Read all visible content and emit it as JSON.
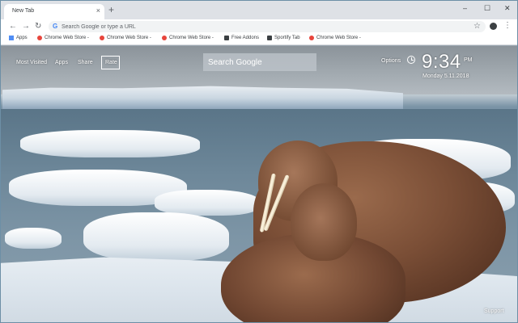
{
  "browser": {
    "tab": {
      "title": "New Tab",
      "close_icon": "×"
    },
    "new_tab_icon": "+",
    "window_controls": {
      "minimize": "–",
      "maximize": "☐",
      "close": "✕"
    },
    "nav": {
      "back": "←",
      "forward": "→",
      "reload": "↻"
    },
    "omnibox": {
      "placeholder": "Search Google or type a URL",
      "logo": "G"
    },
    "toolbar_icons": {
      "star": "☆",
      "menu": "⋮"
    }
  },
  "bookmarks": [
    {
      "label": "Apps",
      "icon": "apps-grid-icon"
    },
    {
      "label": "Chrome Web Store -",
      "icon": "chrome-web-store-icon"
    },
    {
      "label": "Chrome Web Store -",
      "icon": "chrome-web-store-icon"
    },
    {
      "label": "Chrome Web Store -",
      "icon": "chrome-web-store-icon"
    },
    {
      "label": "Free Addons",
      "icon": "free-addons-icon"
    },
    {
      "label": "Sportify Tab",
      "icon": "sportify-icon"
    },
    {
      "label": "Chrome Web Store -",
      "icon": "chrome-web-store-icon"
    }
  ],
  "newtab": {
    "links": {
      "most_visited": "Most Visited",
      "apps": "Apps",
      "share": "Share",
      "rate": "Rate"
    },
    "search_placeholder": "Search Google",
    "options": "Options",
    "time": "9:34",
    "ampm": "PM",
    "date": "Monday  5.11.2018",
    "support": "Support"
  },
  "colors": {
    "accent": "#4285f4",
    "tab_strip": "#dee1e6"
  }
}
